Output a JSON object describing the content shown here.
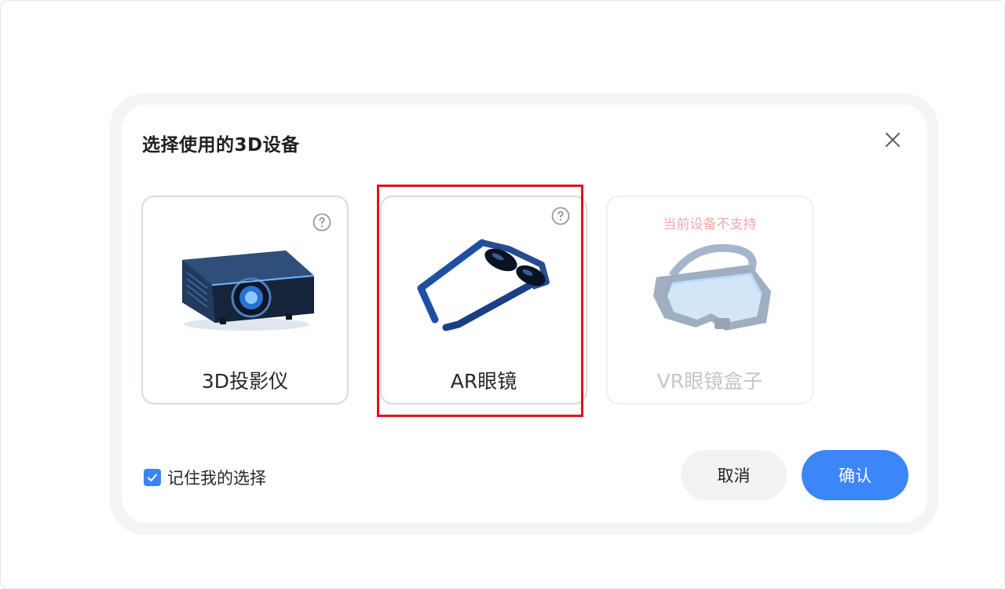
{
  "dialog": {
    "title": "选择使用的3D设备",
    "close_icon": "close-icon"
  },
  "devices": [
    {
      "label": "3D投影仪",
      "icon": "projector-icon",
      "help_icon": "question-circle-icon",
      "state": "available"
    },
    {
      "label": "AR眼镜",
      "icon": "ar-glasses-icon",
      "help_icon": "question-circle-icon",
      "state": "available"
    },
    {
      "label": "VR眼镜盒子",
      "icon": "vr-headset-icon",
      "state": "unsupported",
      "notice": "当前设备不支持"
    }
  ],
  "remember": {
    "label": "记住我的选择",
    "checked": true
  },
  "buttons": {
    "cancel": "取消",
    "confirm": "确认"
  },
  "colors": {
    "primary": "#3b86f8",
    "highlight": "#e2101f",
    "unsupported_text": "#f0a8ab"
  }
}
